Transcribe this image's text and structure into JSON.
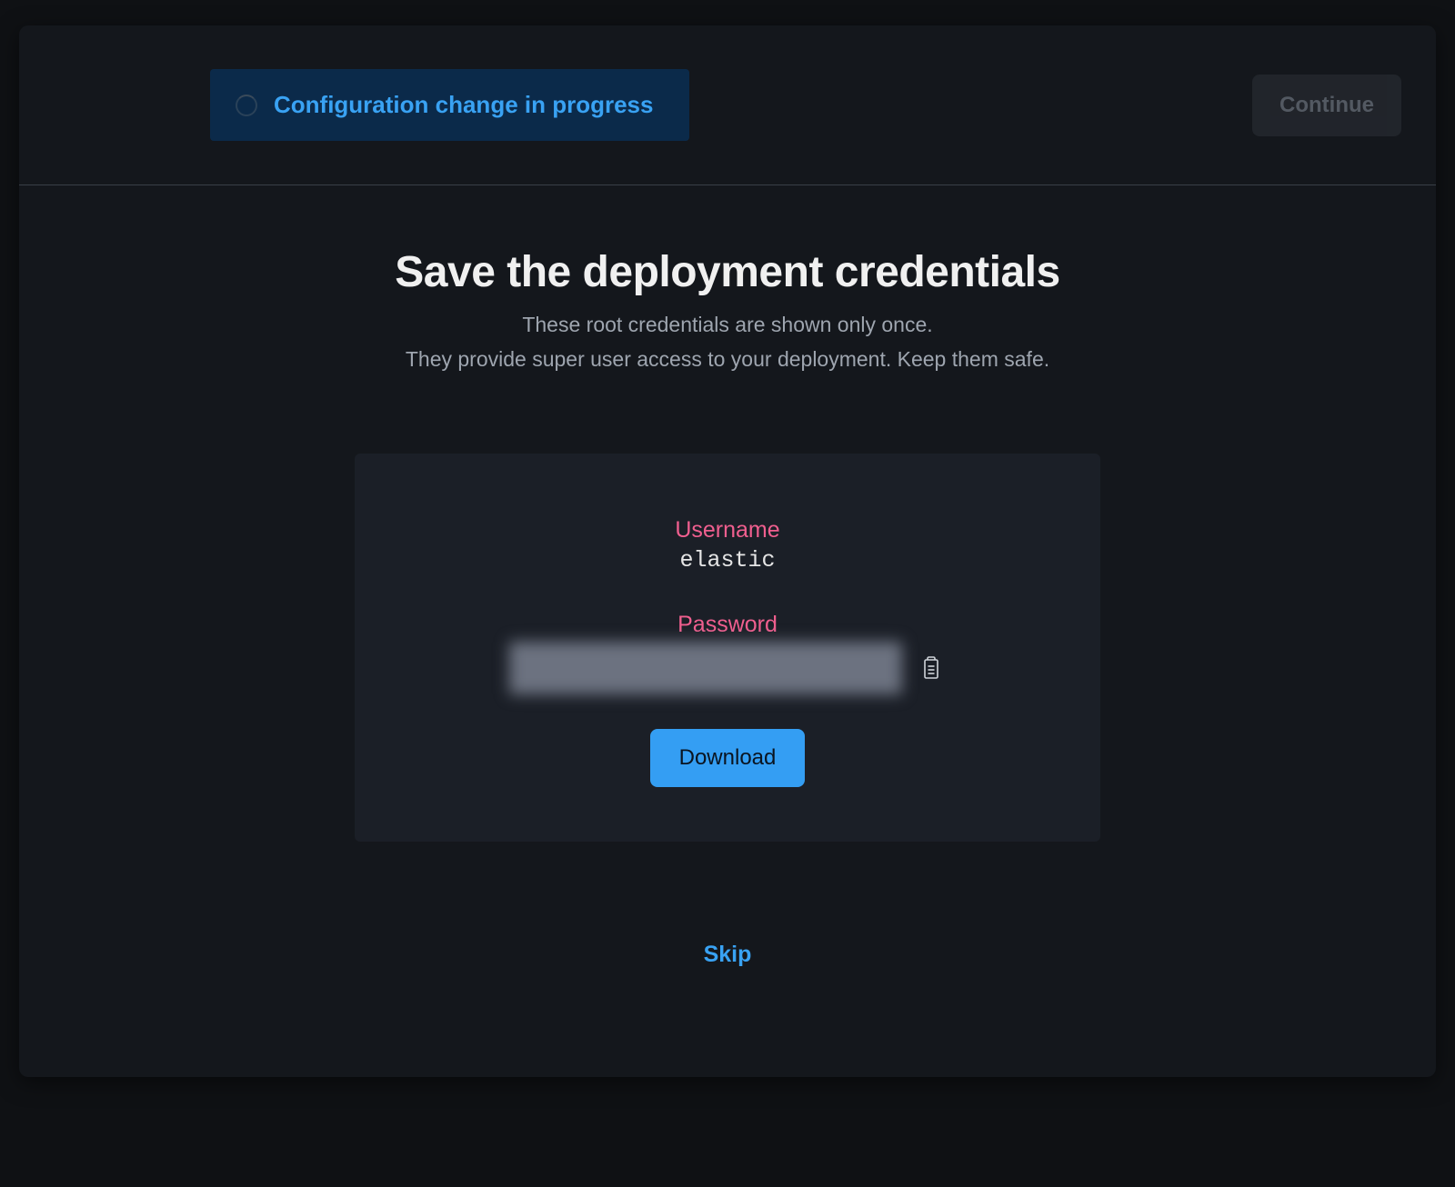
{
  "header": {
    "status_text": "Configuration change in progress",
    "continue_label": "Continue"
  },
  "main": {
    "title": "Save the deployment credentials",
    "subtitle_line1": "These root credentials are shown only once.",
    "subtitle_line2": "They provide super user access to your deployment. Keep them safe."
  },
  "credentials": {
    "username_label": "Username",
    "username_value": "elastic",
    "password_label": "Password",
    "download_label": "Download"
  },
  "footer": {
    "skip_label": "Skip"
  }
}
